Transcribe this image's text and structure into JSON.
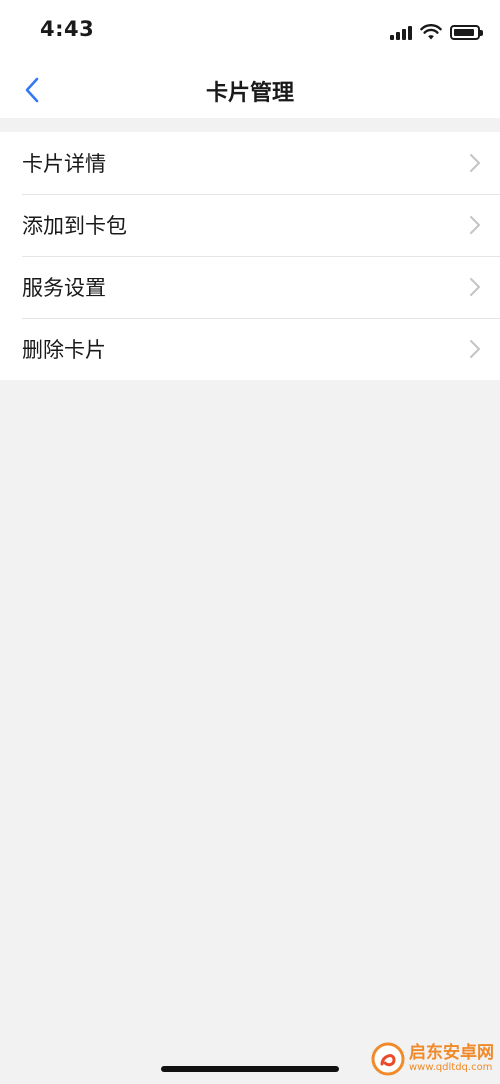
{
  "status_bar": {
    "time": "4:43",
    "icons": [
      "signal-icon",
      "wifi-icon",
      "battery-icon"
    ]
  },
  "nav": {
    "title": "卡片管理",
    "back_icon": "chevron-left-icon",
    "accent_color": "#3478f6"
  },
  "menu": {
    "items": [
      {
        "label": "卡片详情",
        "icon": "chevron-right-icon"
      },
      {
        "label": "添加到卡包",
        "icon": "chevron-right-icon"
      },
      {
        "label": "服务设置",
        "icon": "chevron-right-icon"
      },
      {
        "label": "删除卡片",
        "icon": "chevron-right-icon"
      }
    ]
  },
  "watermark": {
    "title": "启东安卓网",
    "url": "www.qdltdq.com",
    "color": "#f08a2a"
  }
}
